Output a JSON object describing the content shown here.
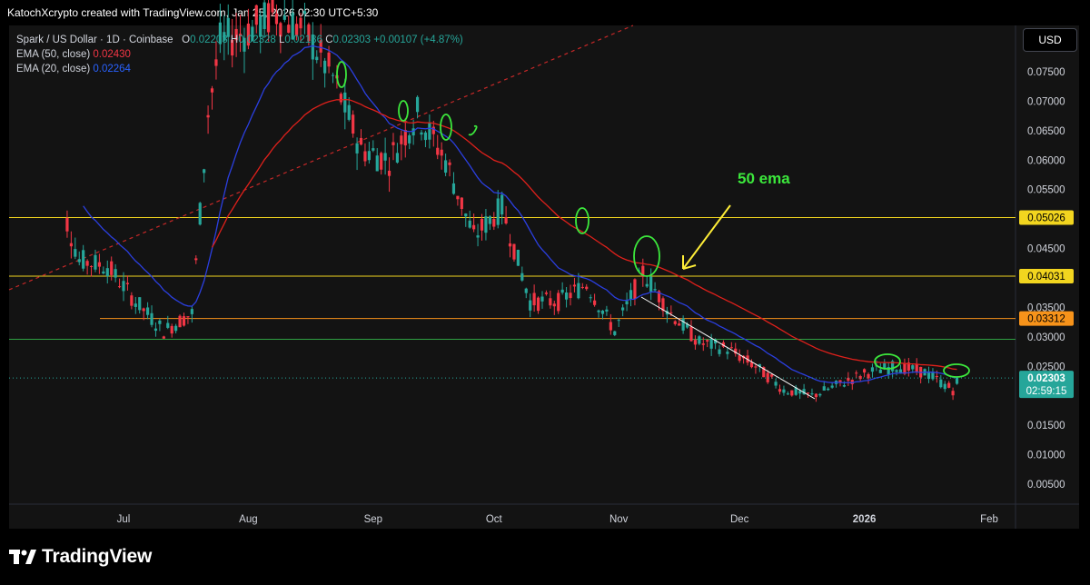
{
  "header": {
    "attribution": "KatochXcrypto created with TradingView.com, Jan 25, 2026 02:30 UTC+5:30"
  },
  "legend": {
    "symbol": "Spark / US Dollar · 1D · Coinbase",
    "o_label": "O",
    "o_value": "0.02203",
    "h_label": "H",
    "h_value": "0.02328",
    "l_label": "L",
    "l_value": "0.02186",
    "c_label": "C",
    "c_value": "0.02303",
    "change": "+0.00107 (+4.87%)",
    "ema50_label": "EMA (50, close)",
    "ema50_value": "0.02430",
    "ema20_label": "EMA (20, close)",
    "ema20_value": "0.02264"
  },
  "currency_button": "USD",
  "footer": {
    "brand": "TradingView"
  },
  "colors": {
    "up": "#26a69a",
    "down": "#f23645",
    "ema50": "#e0201b",
    "ema20": "#2b3fe0",
    "hline_yellow": "#f2d51f",
    "hline_orange": "#f7931a",
    "hline_green": "#2ea043",
    "annotation_green": "#3ce83c",
    "annotation_yellow": "#ffee38"
  },
  "chart_data": {
    "type": "candlestick",
    "title": "Spark / US Dollar · 1D · Coinbase",
    "x_tick_labels": [
      "Jul",
      "Aug",
      "Sep",
      "Oct",
      "Nov",
      "Dec",
      "2026",
      "Feb"
    ],
    "y_tick_labels": [
      "0.07500",
      "0.07000",
      "0.06500",
      "0.06000",
      "0.05500",
      "0.04500",
      "0.03500",
      "0.03000",
      "0.02500",
      "0.01500",
      "0.01000",
      "0.00500"
    ],
    "y_range": [
      0.001,
      0.082
    ],
    "x_range": [
      "2025-06-11",
      "2026-02-06"
    ],
    "last_price": {
      "value": 0.02303,
      "label": "0.02303",
      "countdown": "02:59:15"
    },
    "horizontal_levels": [
      {
        "value": 0.05026,
        "label": "0.05026",
        "color": "yellow"
      },
      {
        "value": 0.04031,
        "label": "0.04031",
        "color": "yellow"
      },
      {
        "value": 0.03312,
        "label": "0.03312",
        "color": "orange"
      },
      {
        "value": 0.0296,
        "label": "",
        "color": "green"
      }
    ],
    "closes_weekly": [
      {
        "date": "2025-06-13",
        "close": 0.058
      },
      {
        "date": "2025-06-20",
        "close": 0.043
      },
      {
        "date": "2025-06-27",
        "close": 0.042
      },
      {
        "date": "2025-07-04",
        "close": 0.036
      },
      {
        "date": "2025-07-11",
        "close": 0.031
      },
      {
        "date": "2025-07-18",
        "close": 0.034
      },
      {
        "date": "2025-07-22",
        "close": 0.068
      },
      {
        "date": "2025-07-25",
        "close": 0.08
      },
      {
        "date": "2025-08-01",
        "close": 0.082
      },
      {
        "date": "2025-08-08",
        "close": 0.085
      },
      {
        "date": "2025-08-15",
        "close": 0.082
      },
      {
        "date": "2025-08-22",
        "close": 0.074
      },
      {
        "date": "2025-08-29",
        "close": 0.062
      },
      {
        "date": "2025-09-05",
        "close": 0.06
      },
      {
        "date": "2025-09-12",
        "close": 0.068
      },
      {
        "date": "2025-09-19",
        "close": 0.06
      },
      {
        "date": "2025-09-26",
        "close": 0.047
      },
      {
        "date": "2025-10-03",
        "close": 0.052
      },
      {
        "date": "2025-10-10",
        "close": 0.036
      },
      {
        "date": "2025-10-17",
        "close": 0.036
      },
      {
        "date": "2025-10-24",
        "close": 0.039
      },
      {
        "date": "2025-10-31",
        "close": 0.031
      },
      {
        "date": "2025-11-07",
        "close": 0.041
      },
      {
        "date": "2025-11-14",
        "close": 0.034
      },
      {
        "date": "2025-11-21",
        "close": 0.029
      },
      {
        "date": "2025-11-28",
        "close": 0.028
      },
      {
        "date": "2025-12-05",
        "close": 0.025
      },
      {
        "date": "2025-12-12",
        "close": 0.021
      },
      {
        "date": "2025-12-19",
        "close": 0.02
      },
      {
        "date": "2025-12-26",
        "close": 0.022
      },
      {
        "date": "2026-01-02",
        "close": 0.024
      },
      {
        "date": "2026-01-09",
        "close": 0.025
      },
      {
        "date": "2026-01-16",
        "close": 0.024
      },
      {
        "date": "2026-01-23",
        "close": 0.021
      },
      {
        "date": "2026-01-24",
        "close": 0.02303
      }
    ],
    "annotations": [
      {
        "type": "text",
        "text": "50 ema"
      }
    ]
  }
}
